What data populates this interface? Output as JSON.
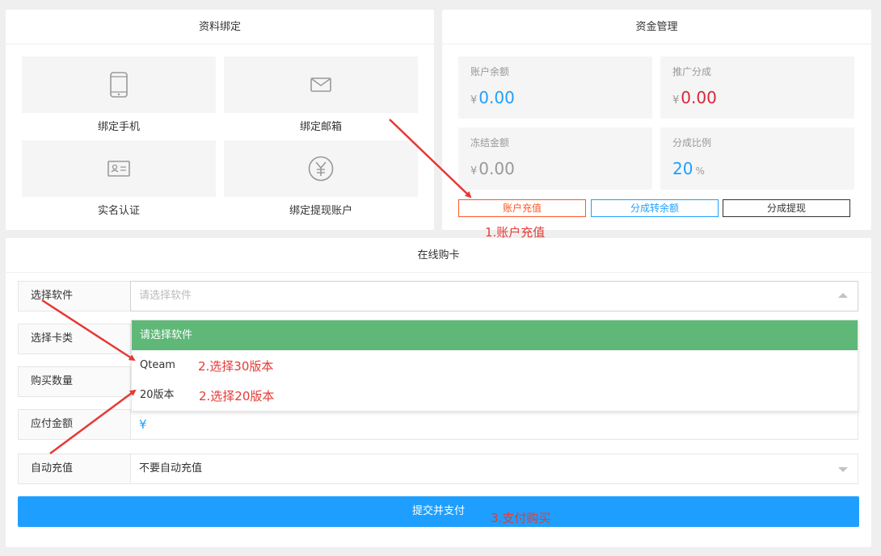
{
  "binding": {
    "title": "资料绑定",
    "tiles": [
      {
        "label": "绑定手机",
        "icon": "phone-icon"
      },
      {
        "label": "绑定邮箱",
        "icon": "mail-icon"
      },
      {
        "label": "实名认证",
        "icon": "id-card-icon"
      },
      {
        "label": "绑定提现账户",
        "icon": "yuan-icon"
      }
    ]
  },
  "funds": {
    "title": "资金管理",
    "balance": {
      "label": "账户余额",
      "currency": "¥",
      "value": "0.00",
      "color": "#1e9fff"
    },
    "promo": {
      "label": "推广分成",
      "currency": "¥",
      "value": "0.00",
      "color": "#d9263a"
    },
    "frozen": {
      "label": "冻结金额",
      "currency": "¥",
      "value": "0.00",
      "color": "#999999"
    },
    "ratio": {
      "label": "分成比例",
      "value": "20",
      "unit": "%",
      "color": "#1e9fff"
    },
    "buttons": {
      "recharge": "账户充值",
      "to_balance": "分成转余额",
      "withdraw": "分成提现"
    }
  },
  "purchase": {
    "title": "在线购卡",
    "software": {
      "label": "选择软件",
      "placeholder": "请选择软件"
    },
    "card_type": {
      "label": "选择卡类"
    },
    "quantity": {
      "label": "购买数量"
    },
    "amount": {
      "label": "应付金额",
      "currency": "¥"
    },
    "auto_recharge": {
      "label": "自动充值",
      "value": "不要自动充值"
    },
    "dropdown": {
      "options": [
        "请选择软件",
        "Qteam",
        "20版本"
      ],
      "selected_color": "#5fb878"
    },
    "submit": "提交并支付"
  },
  "annotations": {
    "step1": "1.账户充值",
    "step2a": "2.选择30版本",
    "step2b": "2.选择20版本",
    "step3": "3.支付购买"
  }
}
